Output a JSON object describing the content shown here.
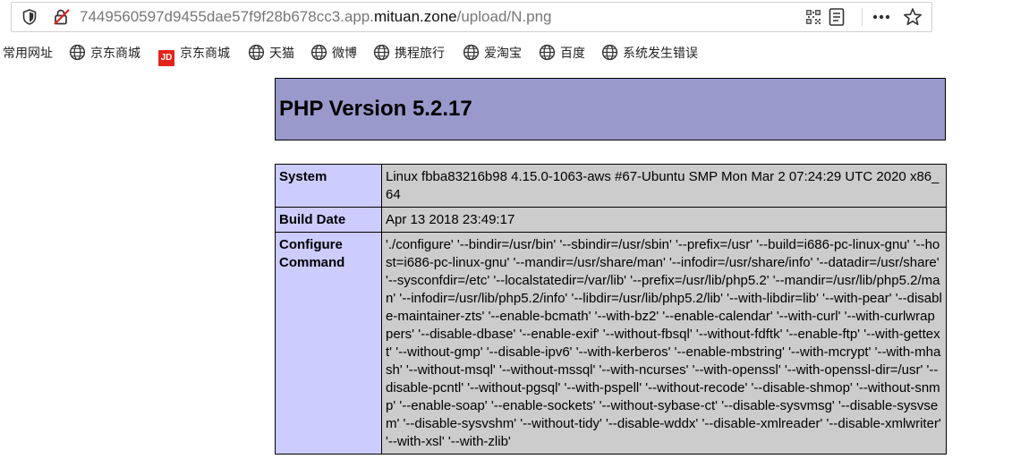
{
  "browser": {
    "url_prefix": "7449560597d9455dae57f9f28b678cc3.app.",
    "url_host": "mituan.zone",
    "url_path": "/upload/N.png"
  },
  "bookmarks": [
    {
      "label": "常用网址",
      "icon": "none"
    },
    {
      "label": "京东商城",
      "icon": "globe-icon"
    },
    {
      "label": "京东商城",
      "icon": "jd-logo"
    },
    {
      "label": "天猫",
      "icon": "globe-icon"
    },
    {
      "label": "微博",
      "icon": "globe-icon"
    },
    {
      "label": "携程旅行",
      "icon": "globe-icon"
    },
    {
      "label": "爱淘宝",
      "icon": "globe-icon"
    },
    {
      "label": "百度",
      "icon": "globe-icon"
    },
    {
      "label": "系统发生错误",
      "icon": "globe-icon"
    }
  ],
  "jd_logo_text": "JD",
  "php": {
    "title": "PHP Version 5.2.17",
    "header_color": "#9999cc",
    "rows": [
      {
        "key": "System",
        "value": "Linux fbba83216b98 4.15.0-1063-aws #67-Ubuntu SMP Mon Mar 2 07:24:29 UTC 2020 x86_64"
      },
      {
        "key": "Build Date",
        "value": "Apr 13 2018 23:49:17"
      },
      {
        "key": "Configure Command",
        "value": "'./configure' '--bindir=/usr/bin' '--sbindir=/usr/sbin' '--prefix=/usr' '--build=i686-pc-linux-gnu' '--host=i686-pc-linux-gnu' '--mandir=/usr/share/man' '--infodir=/usr/share/info' '--datadir=/usr/share' '--sysconfdir=/etc' '--localstatedir=/var/lib' '--prefix=/usr/lib/php5.2' '--mandir=/usr/lib/php5.2/man' '--infodir=/usr/lib/php5.2/info' '--libdir=/usr/lib/php5.2/lib' '--with-libdir=lib' '--with-pear' '--disable-maintainer-zts' '--enable-bcmath' '--with-bz2' '--enable-calendar' '--with-curl' '--with-curlwrappers' '--disable-dbase' '--enable-exif' '--without-fbsql' '--without-fdftk' '--enable-ftp' '--with-gettext' '--without-gmp' '--disable-ipv6' '--with-kerberos' '--enable-mbstring' '--with-mcrypt' '--with-mhash' '--without-msql' '--without-mssql' '--with-ncurses' '--with-openssl' '--with-openssl-dir=/usr' '--disable-pcntl' '--without-pgsql' '--with-pspell' '--without-recode' '--disable-shmop' '--without-snmp' '--enable-soap' '--enable-sockets' '--without-sybase-ct' '--disable-sysvmsg' '--disable-sysvsem' '--disable-sysvshm' '--without-tidy' '--disable-wddx' '--disable-xmlreader' '--disable-xmlwriter' '--with-xsl' '--with-zlib'"
      }
    ]
  }
}
